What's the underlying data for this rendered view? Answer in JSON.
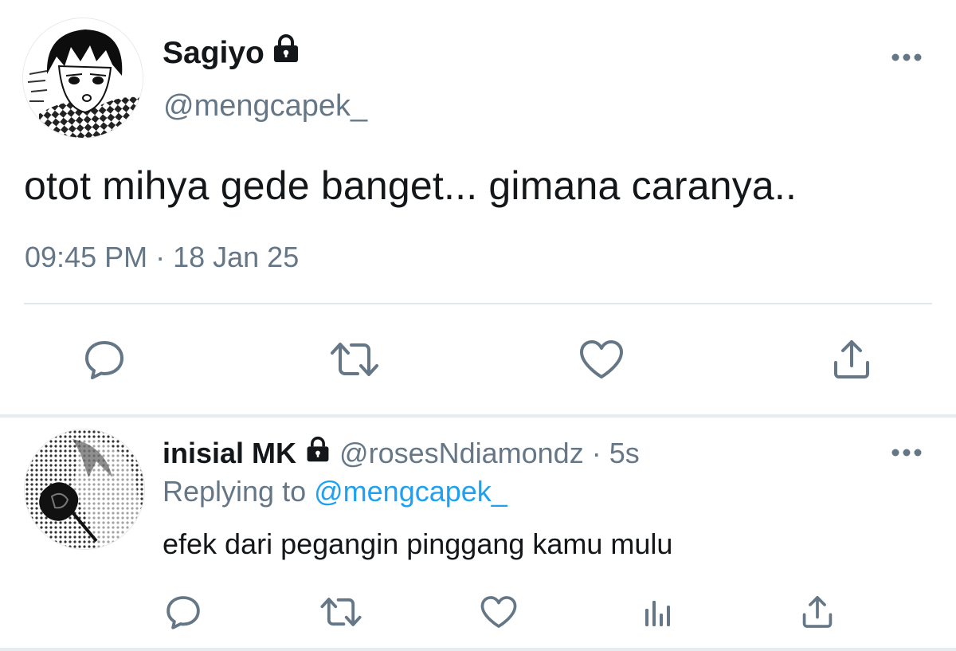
{
  "colors": {
    "text_primary": "#14171a",
    "text_secondary": "#657786",
    "link": "#1da1f2",
    "divider": "#e1e8ed",
    "icon": "#657786"
  },
  "main_tweet": {
    "display_name": "Sagiyo",
    "handle": "@mengcapek_",
    "protected_icon": "lock-icon",
    "text": "otot mihya gede banget... gimana caranya..",
    "timestamp": "09:45 PM · 18 Jan 25",
    "more_icon": "more-horizontal-icon",
    "actions": [
      {
        "name": "reply",
        "icon": "reply-icon"
      },
      {
        "name": "retweet",
        "icon": "retweet-icon"
      },
      {
        "name": "like",
        "icon": "heart-icon"
      },
      {
        "name": "share",
        "icon": "share-icon"
      }
    ]
  },
  "reply_tweet": {
    "display_name": "inisial MK",
    "handle": "@rosesNdiamondz",
    "separator": "·",
    "age": "5s",
    "protected_icon": "lock-icon",
    "replying_prefix": "Replying to",
    "replying_to": "@mengcapek_",
    "text": "efek dari pegangin pinggang kamu mulu",
    "more_icon": "more-horizontal-icon",
    "actions": [
      {
        "name": "reply",
        "icon": "reply-icon"
      },
      {
        "name": "retweet",
        "icon": "retweet-icon"
      },
      {
        "name": "like",
        "icon": "heart-icon"
      },
      {
        "name": "analytics",
        "icon": "analytics-icon"
      },
      {
        "name": "share",
        "icon": "share-icon"
      }
    ]
  }
}
